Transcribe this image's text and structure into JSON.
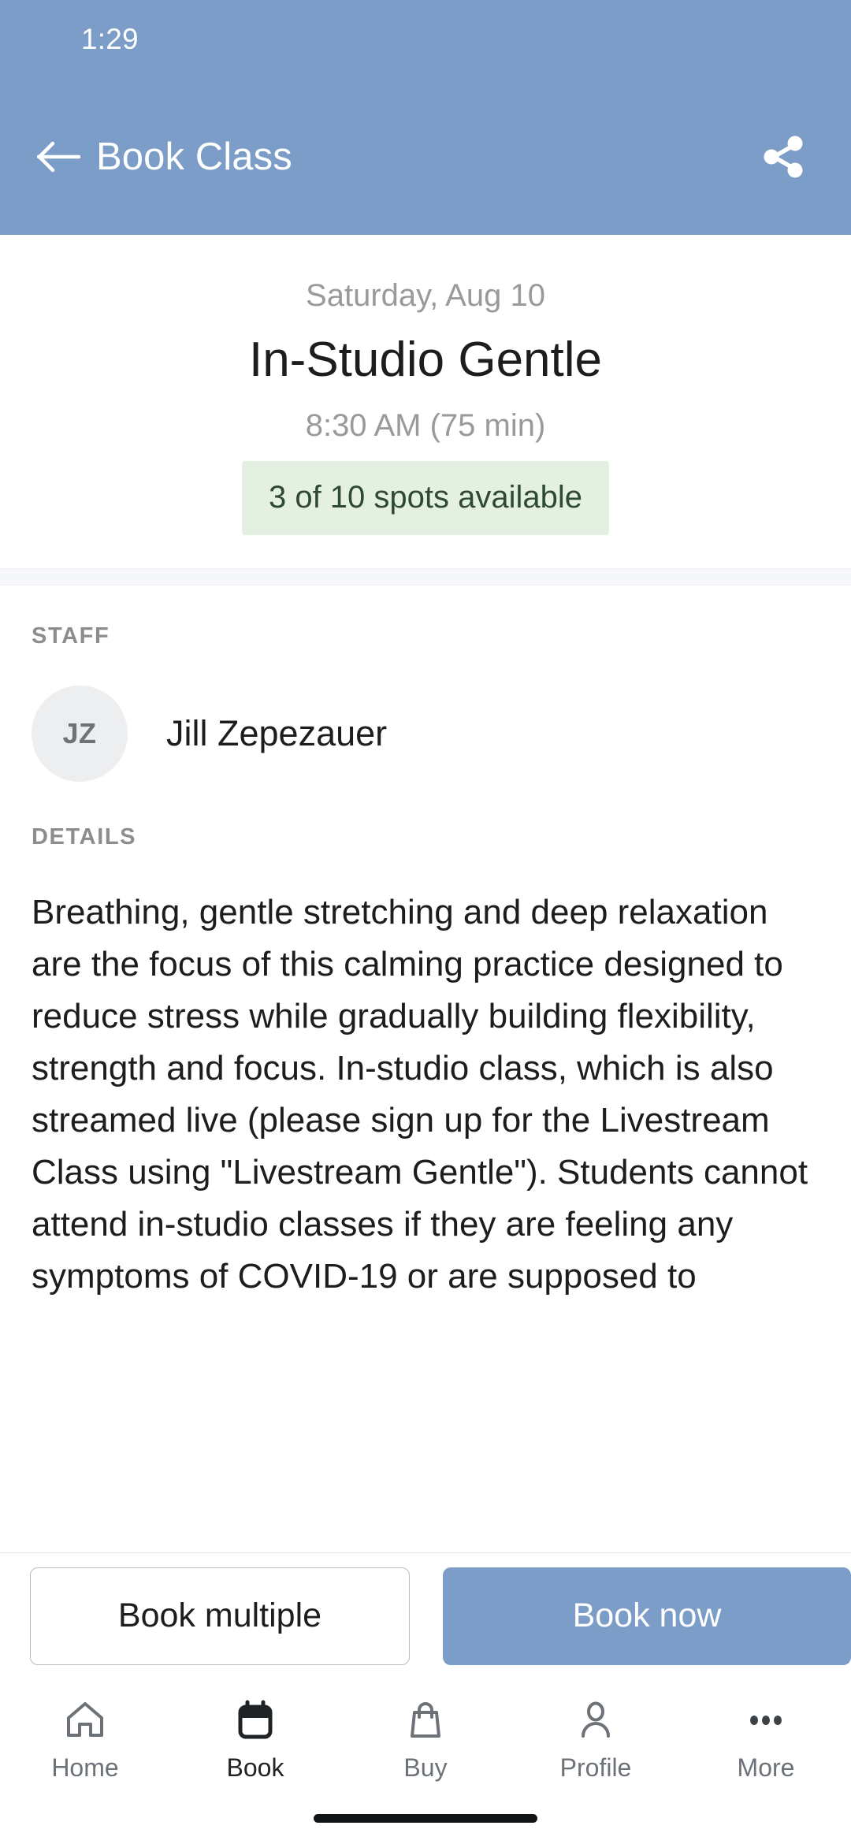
{
  "status_bar": {
    "time": "1:29"
  },
  "appbar": {
    "title": "Book Class",
    "back_icon": "arrow-left-icon",
    "share_icon": "share-icon",
    "background_color": "#7b9dc7"
  },
  "class": {
    "date": "Saturday, Aug 10",
    "title": "In-Studio Gentle",
    "time": "8:30 AM (75 min)",
    "availability": "3 of 10 spots available",
    "availability_bg_color": "#e4f0e2",
    "availability_text_color": "#2f4a32"
  },
  "staff": {
    "section_label": "STAFF",
    "avatar_initials": "JZ",
    "name": "Jill Zepezauer"
  },
  "details": {
    "section_label": "DETAILS",
    "text": "Breathing, gentle stretching and deep relaxation are the focus of this calming practice designed to reduce stress while gradually building flexibility, strength and focus. In-studio class, which is also streamed live (please sign up for the Livestream Class using \"Livestream Gentle\"). Students cannot attend in-studio classes if they are feeling any symptoms of COVID-19 or are supposed to"
  },
  "actions": {
    "secondary_label": "Book multiple",
    "primary_label": "Book now",
    "primary_color": "#7b9dc7"
  },
  "bottom_nav": {
    "items": [
      {
        "label": "Home",
        "icon": "home-icon",
        "active": false
      },
      {
        "label": "Book",
        "icon": "calendar-icon",
        "active": true
      },
      {
        "label": "Buy",
        "icon": "bag-icon",
        "active": false
      },
      {
        "label": "Profile",
        "icon": "person-icon",
        "active": false
      },
      {
        "label": "More",
        "icon": "ellipsis-icon",
        "active": false
      }
    ]
  }
}
